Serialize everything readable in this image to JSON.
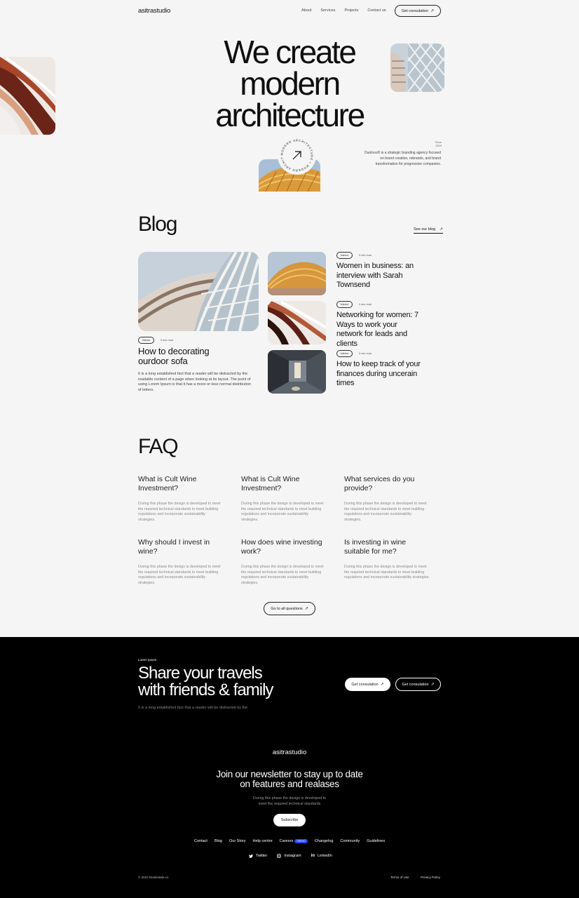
{
  "nav": {
    "brand": "asitrastudio",
    "links": [
      "About",
      "Services",
      "Projects",
      "Contact us"
    ],
    "cta": "Get consulation"
  },
  "hero": {
    "title_lines": [
      "We create",
      "modern",
      "architecture"
    ],
    "side_label": "Since 2015",
    "badge_text": "MODERN ARCHITECTURE • MODERN ARCHITECTURE •",
    "description": "Duolooo® is a strategic branding agency focused on brand creation, rebrands, and brand transformation for progressive companies."
  },
  "blog": {
    "heading": "Blog",
    "see_all": "See our blog",
    "featured": {
      "tag": "Interior",
      "read_time": "9 min read",
      "title": "How to decorating ourdoor sofa",
      "excerpt": "It is a long established fact that a reader will be distracted by the readable content of a page when looking at its layout. The point of using Lorem Ipsum is that it has a more-or-less normal distribution of letters."
    },
    "posts": [
      {
        "tag": "Interior",
        "read_time": "9 min read",
        "title": "Women in business: an interview with Sarah Townsend"
      },
      {
        "tag": "Interior",
        "read_time": "9 min read",
        "title": "Networking for women: 7 Ways to work your network for leads and clients"
      },
      {
        "tag": "Interior",
        "read_time": "9 min read",
        "title": "How to keep track of your finances during uncerain times"
      }
    ]
  },
  "faq": {
    "heading": "FAQ",
    "items": [
      {
        "q": "What is Cult Wine Investment?",
        "a": "During this phase the design is developed to meet the required technical standards to meet building regulations and incorporate sustainability strategies."
      },
      {
        "q": "What is Cult Wine Investment?",
        "a": "During this phase the design is developed to meet the required technical standards to meet building regulations and incorporate sustainability strategies."
      },
      {
        "q": "What services do you provide?",
        "a": "During this phase the design is developed to meet the required technical standards to meet building regulations and incorporate sustainability strategies."
      },
      {
        "q": "Why should I invest in wine?",
        "a": "During this phase the design is developed to meet the required technical standards to meet building regulations and incorporate sustainability strategies."
      },
      {
        "q": "How does wine investing work?",
        "a": "During this phase the design is developed to meet the required technical standards to meet building regulations and incorporate sustainability strategies."
      },
      {
        "q": "Is investing in wine suitable for me?",
        "a": "During this phase the design is developed to meet the required technical standards to meet building regulations and incorporate sustainability strategies."
      }
    ],
    "all_questions": "Go to all questions"
  },
  "cta": {
    "eyebrow": "Lorem Ipsum",
    "title_lines": [
      "Share your travels",
      "with friends & family"
    ],
    "sub": "It is a long established fact that a reader will be distracted by the",
    "btn_primary": "Get consulation",
    "btn_secondary": "Get consulation"
  },
  "footer": {
    "brand": "asitrastudio",
    "newsletter_lines": [
      "Join our newsletter to stay up to date",
      "on features and realases"
    ],
    "newsletter_sub_lines": [
      "During this phase the design is developed to",
      "meet the required technical standards"
    ],
    "subscribe": "Subscribe",
    "links": [
      "Contact",
      "Blog",
      "Our Story",
      "Help centre",
      "Careers",
      "Changelog",
      "Community",
      "Guidelines"
    ],
    "hiring": "HIRING",
    "socials": [
      "Twitter",
      "Instagram",
      "LinkedIn"
    ],
    "copyright": "© 2023 Realestate.co",
    "terms": "Terms of Use",
    "privacy": "Privacy Policy"
  },
  "colors": {
    "accent": "#2447ff",
    "dark_bg": "#000000",
    "light_bg": "#f5f5f5"
  }
}
